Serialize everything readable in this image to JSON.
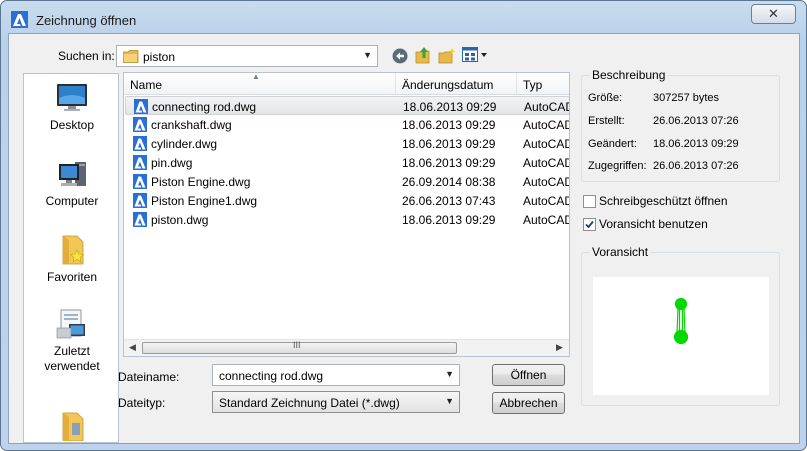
{
  "window": {
    "title": "Zeichnung öffnen",
    "close_glyph": "✕",
    "app_icon": "autocad-logo-icon"
  },
  "lookin": {
    "label": "Suchen in:",
    "value": "piston"
  },
  "places": [
    {
      "label": "Desktop",
      "icon": "desktop-icon"
    },
    {
      "label": "Computer",
      "icon": "computer-icon"
    },
    {
      "label": "Favoriten",
      "icon": "favorites-folder-icon"
    },
    {
      "label": "Zuletzt verwendet",
      "label_line1": "Zuletzt",
      "label_line2": "verwendet",
      "icon": "recent-places-icon"
    },
    {
      "label": "",
      "icon": "library-folder-icon"
    }
  ],
  "columns": {
    "name": "Name",
    "date": "Änderungsdatum",
    "type": "Typ"
  },
  "files": [
    {
      "name": "connecting rod.dwg",
      "date": "18.06.2013 09:29",
      "type": "AutoCAD-"
    },
    {
      "name": "crankshaft.dwg",
      "date": "18.06.2013 09:29",
      "type": "AutoCAD-"
    },
    {
      "name": "cylinder.dwg",
      "date": "18.06.2013 09:29",
      "type": "AutoCAD-"
    },
    {
      "name": "pin.dwg",
      "date": "18.06.2013 09:29",
      "type": "AutoCAD-"
    },
    {
      "name": "Piston Engine.dwg",
      "date": "26.09.2014 08:38",
      "type": "AutoCAD-"
    },
    {
      "name": "Piston Engine1.dwg",
      "date": "26.06.2013 07:43",
      "type": "AutoCAD-"
    },
    {
      "name": "piston.dwg",
      "date": "18.06.2013 09:29",
      "type": "AutoCAD-"
    }
  ],
  "selected_index": 0,
  "filename": {
    "label": "Dateiname:",
    "value": "connecting rod.dwg"
  },
  "filetype": {
    "label": "Dateityp:",
    "value": "Standard Zeichnung Datei (*.dwg)"
  },
  "buttons": {
    "open": "Öffnen",
    "cancel": "Abbrechen"
  },
  "description": {
    "title": "Beschreibung",
    "size_label": "Größe:",
    "size_value": "307257 bytes",
    "created_label": "Erstellt:",
    "created_value": "26.06.2013 07:26",
    "modified_label": "Geändert:",
    "modified_value": "18.06.2013 09:29",
    "accessed_label": "Zugegriffen:",
    "accessed_value": "26.06.2013 07:26"
  },
  "options": {
    "readonly_label": "Schreibgeschützt öffnen",
    "readonly_checked": false,
    "preview_label": "Voransicht benutzen",
    "preview_checked": true
  },
  "preview": {
    "title": "Voransicht",
    "drawing_color": "#00d800"
  },
  "colors": {
    "selection": "#e4e6e9",
    "title_bar": "#bed3eb",
    "preview_green": "#00d800"
  }
}
